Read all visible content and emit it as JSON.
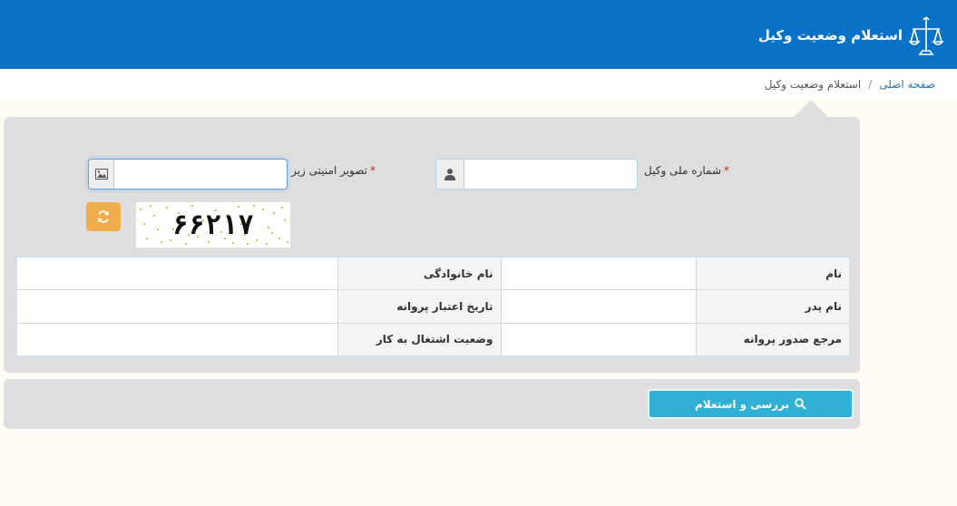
{
  "header": {
    "title": "استعلام وضعیت وکیل",
    "background": "#0a72c6"
  },
  "breadcrumb": {
    "home": "صفحه اصلی",
    "separator": "/",
    "current": "استعلام وضعیت وکیل"
  },
  "form": {
    "national_id": {
      "label": "شماره ملی وکیل",
      "required_mark": "*",
      "value": "",
      "icon": "user-icon"
    },
    "captcha_input": {
      "label": "تصویر امنیتی زیر",
      "required_mark": "*",
      "value": "",
      "icon": "image-icon"
    },
    "captcha_image_text": "۶۶۲۱۷",
    "refresh_icon": "refresh-icon"
  },
  "info_table": {
    "rows": [
      {
        "label_right": "نام",
        "value_right": "",
        "label_left": "نام خانوادگی",
        "value_left": ""
      },
      {
        "label_right": "نام پدر",
        "value_right": "",
        "label_left": "تاریخ اعتبار پروانه",
        "value_left": ""
      },
      {
        "label_right": "مرجع صدور پروانه",
        "value_right": "",
        "label_left": "وضعیت اشتغال به کار",
        "value_left": ""
      }
    ]
  },
  "actions": {
    "inquiry_label": "بررسی و استعلام",
    "inquiry_icon": "search-icon",
    "button_color": "#31b0d5"
  },
  "colors": {
    "panel": "#dedede",
    "page_bg": "#fffcf5",
    "refresh": "#f0ad4e",
    "required": "#d9222a"
  }
}
